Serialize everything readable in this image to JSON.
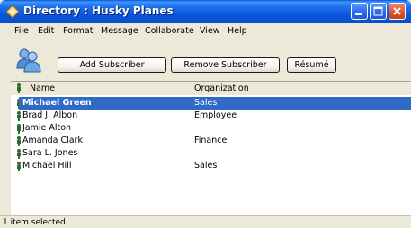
{
  "window": {
    "title": "Directory : Husky Planes",
    "icon": "diamond-app-icon"
  },
  "menu": {
    "items": [
      "File",
      "Edit",
      "Format",
      "Message",
      "Collaborate",
      "View",
      "Help"
    ]
  },
  "toolbar": {
    "add_label": "Add Subscriber",
    "remove_label": "Remove Subscriber",
    "resume_label": "Résumé",
    "icon": "people-icon"
  },
  "table": {
    "columns": [
      "Name",
      "Organization"
    ],
    "rows": [
      {
        "name": "Michael Green",
        "organization": "Sales",
        "selected": true
      },
      {
        "name": "Brad J. Albon",
        "organization": "Employee",
        "selected": false
      },
      {
        "name": "Jamie Alton",
        "organization": "",
        "selected": false
      },
      {
        "name": "Amanda Clark",
        "organization": "Finance",
        "selected": false
      },
      {
        "name": "Sara L. Jones",
        "organization": "",
        "selected": false
      },
      {
        "name": "Michael Hill",
        "organization": "Sales",
        "selected": false
      }
    ]
  },
  "status": {
    "text": "1 item selected."
  },
  "colors": {
    "titlebar": "#0855dd",
    "selection": "#316ac5",
    "close_button": "#d9532d",
    "person_icon": "#2f6b2f"
  }
}
